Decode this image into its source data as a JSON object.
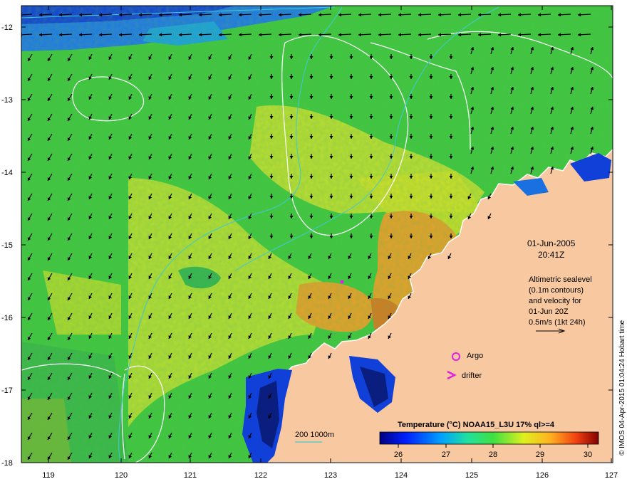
{
  "map": {
    "lon_range": [
      118.6,
      127
    ],
    "lat_range": [
      -18,
      -11.7
    ],
    "lon_ticks": [
      "119",
      "120",
      "121",
      "122",
      "123",
      "124",
      "125",
      "126",
      "127"
    ],
    "lat_ticks": [
      "-12",
      "-13",
      "-14",
      "-15",
      "-16",
      "-17",
      "-18"
    ]
  },
  "annotation": {
    "date": "01-Jun-2005",
    "time": "20:41Z",
    "altimetry_lines": [
      "Altimetric sealevel",
      "(0.1m contours)",
      "and velocity for",
      "01-Jun 20Z",
      "0.5m/s (1kt 24h)"
    ]
  },
  "legend": {
    "argo_label": "Argo",
    "drifter_label": "drifter",
    "argo_color": "#e020e0",
    "drifter_color": "#e020e0"
  },
  "depth_legend": {
    "label": "200  1000m",
    "color": "#40c8d8"
  },
  "colorbar": {
    "title": "Temperature (°C) NOAA15_L3U 17% ql>=4",
    "ticks": [
      "26",
      "27",
      "28",
      "29",
      "30"
    ],
    "range": [
      25.6,
      30.4
    ]
  },
  "credit": "© IMOS 04-Apr-2015 01:04:24 Hobart time",
  "colors": {
    "land": "#f8c8a0",
    "sst_green": "#3ec83e",
    "sst_yellow": "#e8e820",
    "sst_orange": "#e89028",
    "sst_blue": "#1040d8",
    "vector": "#000000",
    "contour": "#ffffff"
  }
}
